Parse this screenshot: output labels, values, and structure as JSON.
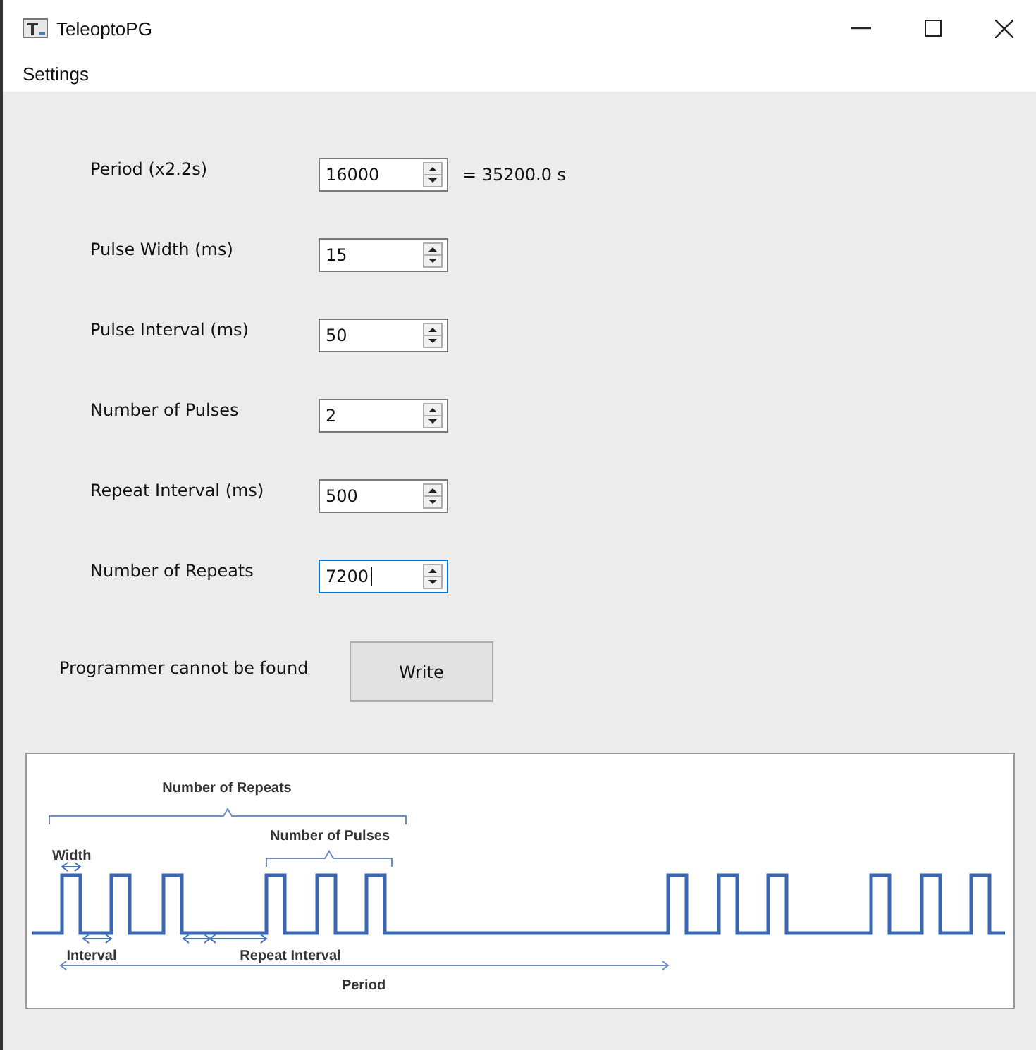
{
  "window": {
    "title": "TeleoptoPG"
  },
  "menu": [
    "Settings"
  ],
  "fields": [
    {
      "label": "Period (x2.2s)",
      "value": "16000",
      "focused": false,
      "result": "= 35200.0 s"
    },
    {
      "label": "Pulse Width (ms)",
      "value": "15",
      "focused": false
    },
    {
      "label": "Pulse Interval (ms)",
      "value": "50",
      "focused": false
    },
    {
      "label": "Number of Pulses",
      "value": "2",
      "focused": false
    },
    {
      "label": "Repeat Interval (ms)",
      "value": "500",
      "focused": false
    },
    {
      "label": "Number of Repeats",
      "value": "7200",
      "focused": true
    }
  ],
  "status": "Programmer cannot be found",
  "buttons": [
    "Write"
  ],
  "diagram": {
    "labels": {
      "repeats": "Number of Repeats",
      "pulses": "Number of Pulses",
      "width": "Width",
      "interval": "Interval",
      "repeat_interval": "Repeat Interval",
      "period": "Period"
    }
  }
}
